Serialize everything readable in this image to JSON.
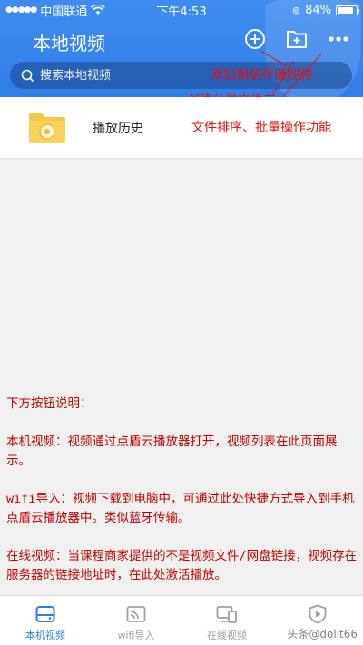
{
  "status_bar": {
    "carrier": "中国联通",
    "time": "下午4:53",
    "battery_pct": "84%",
    "battery_level": 0.84
  },
  "header": {
    "title": "本地视频",
    "icons": [
      "add-circle-icon",
      "folder-add-icon",
      "more-icon"
    ]
  },
  "search": {
    "placeholder": "搜索本地视频"
  },
  "history_row": {
    "label": "播放历史",
    "icon": "folder-icon"
  },
  "annotations": {
    "add": "添加相册存储视频",
    "folder": "创建分类文件夹",
    "more": "文件排序、批量操作功能"
  },
  "notes": [
    "下方按钮说明：",
    "本机视频：视频通过点盾云播放器打开，视频列表在此页面展示。",
    "wifi导入：视频下载到电脑中，可通过此处快捷方式导入到手机点盾云播放器中。类似蓝牙传输。",
    "在线视频：当课程商家提供的不是视频文件/网盘链接，视频存在服务器的链接地址时，在此处激活播放。"
  ],
  "tabs": [
    {
      "label": "本机视频",
      "icon": "storage-icon",
      "active": true
    },
    {
      "label": "wifi导入",
      "icon": "wifi-cast-icon",
      "active": false
    },
    {
      "label": "在线视频",
      "icon": "devices-icon",
      "active": false
    },
    {
      "label": "",
      "icon": "shield-play-icon",
      "active": false
    }
  ],
  "watermark": "头条@dolit66",
  "colors": {
    "primary": "#2f7ee8",
    "annotation": "#e01010"
  }
}
